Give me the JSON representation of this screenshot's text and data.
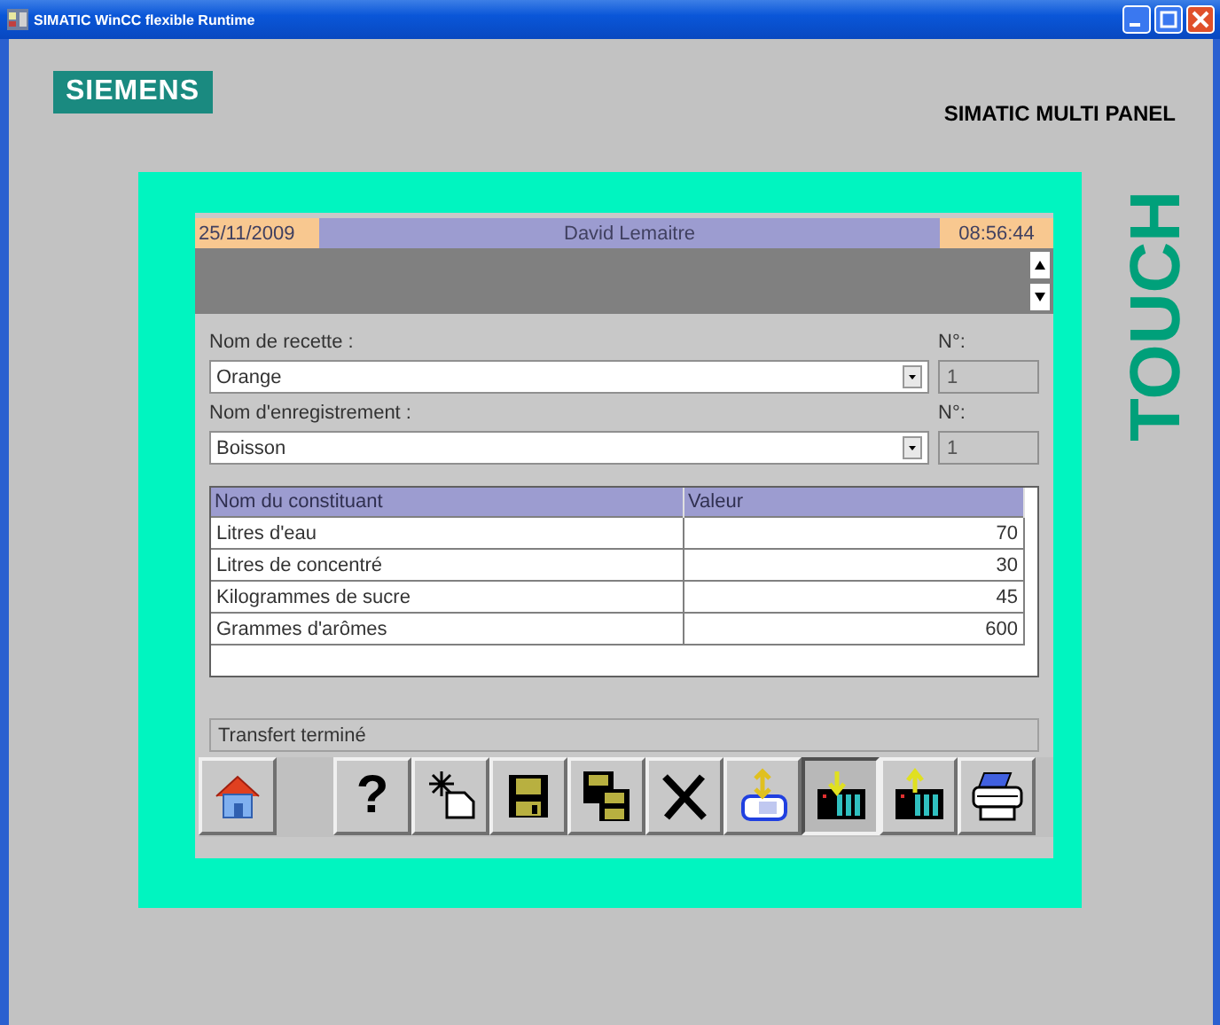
{
  "window": {
    "title": "SIMATIC WinCC flexible Runtime"
  },
  "brand": {
    "logo": "SIEMENS",
    "product": "SIMATIC MULTI PANEL",
    "side_label": "TOUCH"
  },
  "header": {
    "date": "25/11/2009",
    "user": "David Lemaitre",
    "time": "08:56:44"
  },
  "fields": [
    {
      "label": "Nom de recette :",
      "value": "Orange",
      "number_label": "N°:",
      "number": "1"
    },
    {
      "label": "Nom d'enregistrement :",
      "value": "Boisson",
      "number_label": "N°:",
      "number": "1"
    }
  ],
  "table": {
    "columns": [
      "Nom du constituant",
      "Valeur"
    ],
    "rows": [
      [
        "Litres d'eau",
        "70"
      ],
      [
        "Litres de concentré",
        "30"
      ],
      [
        "Kilogrammes de sucre",
        "45"
      ],
      [
        "Grammes d'arômes",
        "600"
      ]
    ]
  },
  "status": "Transfert terminé",
  "toolbar": [
    {
      "kind": "home",
      "pressed": false
    },
    {
      "kind": "help",
      "text": "?",
      "pressed": false
    },
    {
      "kind": "new",
      "pressed": false
    },
    {
      "kind": "save",
      "pressed": false
    },
    {
      "kind": "save_as",
      "pressed": false
    },
    {
      "kind": "delete",
      "pressed": false
    },
    {
      "kind": "import",
      "pressed": false
    },
    {
      "kind": "download",
      "pressed": true
    },
    {
      "kind": "upload",
      "pressed": false
    },
    {
      "kind": "print",
      "pressed": false
    }
  ]
}
